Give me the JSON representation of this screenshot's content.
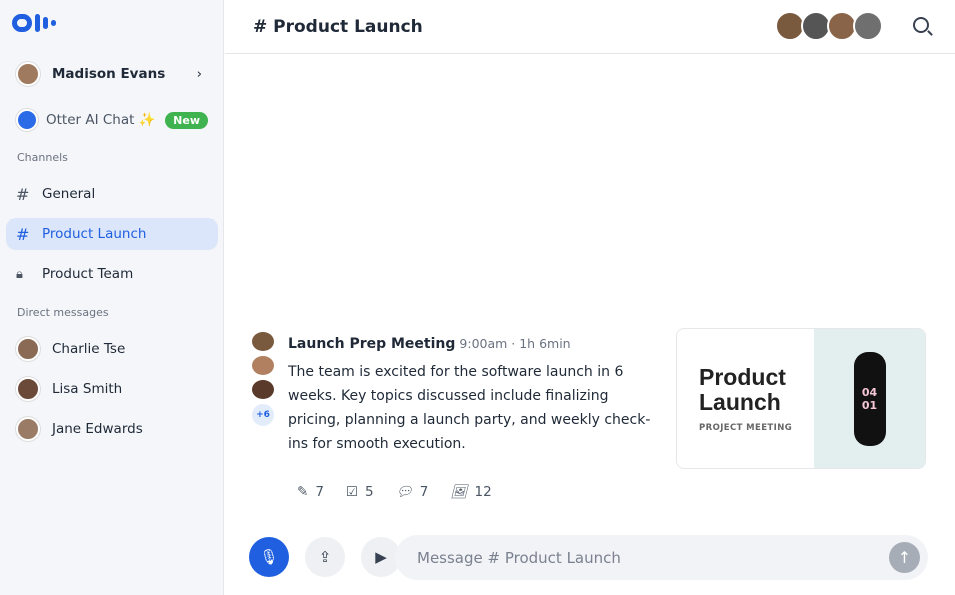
{
  "sidebar": {
    "user": "Madison Evans",
    "otter_chat": "Otter AI Chat ✨",
    "new_badge": "New",
    "channels_label": "Channels",
    "channels": [
      {
        "label": "General",
        "icon": "hash-icon"
      },
      {
        "label": "Product Launch",
        "icon": "hash-icon",
        "active": true
      },
      {
        "label": "Product Team",
        "icon": "lock-icon"
      }
    ],
    "dm_label": "Direct messages",
    "dms": [
      {
        "label": "Charlie Tse"
      },
      {
        "label": "Lisa Smith"
      },
      {
        "label": "Jane Edwards"
      }
    ]
  },
  "header": {
    "title": "# Product Launch"
  },
  "message": {
    "title": "Launch Prep Meeting",
    "time": "9:00am · 1h 6min",
    "more": "+6",
    "body": "The team is excited for the software launch in 6 weeks. Key topics discussed include finalizing pricing, planning a launch party, and weekly check-ins for smooth execution.",
    "stats": {
      "edits": "7",
      "tasks": "5",
      "comments": "7",
      "images": "12"
    },
    "card": {
      "title": "Product Launch",
      "subtitle": "PROJECT MEETING",
      "watch": "04 01"
    }
  },
  "composer": {
    "placeholder": "Message # Product Launch"
  },
  "colors": {
    "accent": "#1f5fe0",
    "badge": "#3fb34f"
  }
}
